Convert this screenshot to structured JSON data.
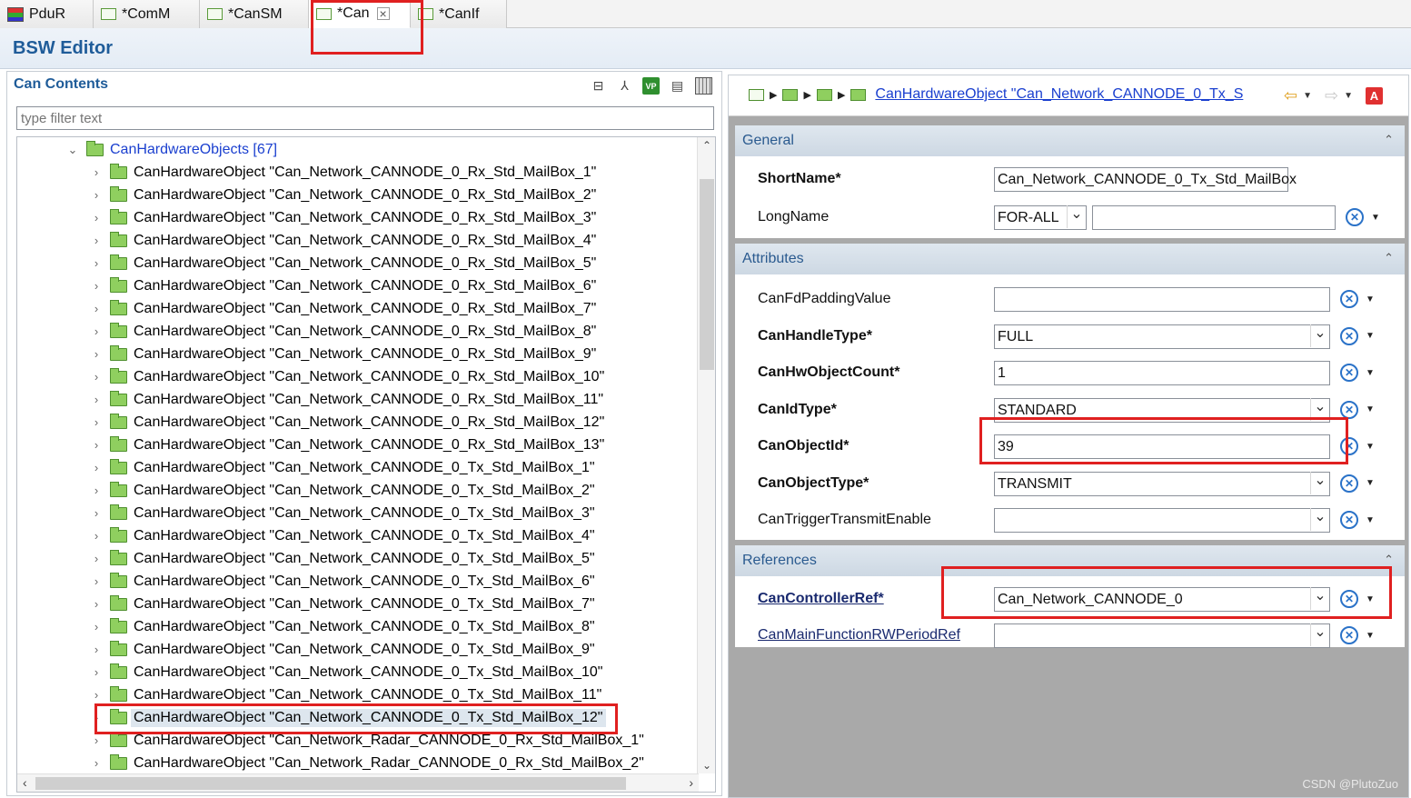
{
  "tabs": [
    {
      "label": "PduR",
      "icon": "pdur-module-icon"
    },
    {
      "label": "*ComM",
      "icon": "module-icon"
    },
    {
      "label": "*CanSM",
      "icon": "module-icon"
    },
    {
      "label": "*Can",
      "icon": "module-icon",
      "active": true
    },
    {
      "label": "*CanIf",
      "icon": "module-icon"
    }
  ],
  "editor_title": "BSW Editor",
  "left_pane": {
    "title": "Can Contents",
    "filter_placeholder": "type filter text",
    "tools": [
      "collapse-all-icon",
      "hierarchy-icon",
      "vp-res-icon",
      "document-icon",
      "grid-table-icon"
    ],
    "group_label": "CanHardwareObjects [67]",
    "items": [
      "CanHardwareObject \"Can_Network_CANNODE_0_Rx_Std_MailBox_1\"",
      "CanHardwareObject \"Can_Network_CANNODE_0_Rx_Std_MailBox_2\"",
      "CanHardwareObject \"Can_Network_CANNODE_0_Rx_Std_MailBox_3\"",
      "CanHardwareObject \"Can_Network_CANNODE_0_Rx_Std_MailBox_4\"",
      "CanHardwareObject \"Can_Network_CANNODE_0_Rx_Std_MailBox_5\"",
      "CanHardwareObject \"Can_Network_CANNODE_0_Rx_Std_MailBox_6\"",
      "CanHardwareObject \"Can_Network_CANNODE_0_Rx_Std_MailBox_7\"",
      "CanHardwareObject \"Can_Network_CANNODE_0_Rx_Std_MailBox_8\"",
      "CanHardwareObject \"Can_Network_CANNODE_0_Rx_Std_MailBox_9\"",
      "CanHardwareObject \"Can_Network_CANNODE_0_Rx_Std_MailBox_10\"",
      "CanHardwareObject \"Can_Network_CANNODE_0_Rx_Std_MailBox_11\"",
      "CanHardwareObject \"Can_Network_CANNODE_0_Rx_Std_MailBox_12\"",
      "CanHardwareObject \"Can_Network_CANNODE_0_Rx_Std_MailBox_13\"",
      "CanHardwareObject \"Can_Network_CANNODE_0_Tx_Std_MailBox_1\"",
      "CanHardwareObject \"Can_Network_CANNODE_0_Tx_Std_MailBox_2\"",
      "CanHardwareObject \"Can_Network_CANNODE_0_Tx_Std_MailBox_3\"",
      "CanHardwareObject \"Can_Network_CANNODE_0_Tx_Std_MailBox_4\"",
      "CanHardwareObject \"Can_Network_CANNODE_0_Tx_Std_MailBox_5\"",
      "CanHardwareObject \"Can_Network_CANNODE_0_Tx_Std_MailBox_6\"",
      "CanHardwareObject \"Can_Network_CANNODE_0_Tx_Std_MailBox_7\"",
      "CanHardwareObject \"Can_Network_CANNODE_0_Tx_Std_MailBox_8\"",
      "CanHardwareObject \"Can_Network_CANNODE_0_Tx_Std_MailBox_9\"",
      "CanHardwareObject \"Can_Network_CANNODE_0_Tx_Std_MailBox_10\"",
      "CanHardwareObject \"Can_Network_CANNODE_0_Tx_Std_MailBox_11\"",
      "CanHardwareObject \"Can_Network_CANNODE_0_Tx_Std_MailBox_12\"",
      "CanHardwareObject \"Can_Network_Radar_CANNODE_0_Rx_Std_MailBox_1\"",
      "CanHardwareObject \"Can_Network_Radar_CANNODE_0_Rx_Std_MailBox_2\""
    ],
    "selected_index": 24
  },
  "right_pane": {
    "breadcrumb_link": "CanHardwareObject \"Can_Network_CANNODE_0_Tx_S",
    "nav_icons": [
      "back-arrow-icon",
      "forward-arrow-icon",
      "autosar-a-icon"
    ],
    "general": {
      "title": "General",
      "shortname_label": "ShortName*",
      "shortname_value": "Can_Network_CANNODE_0_Tx_Std_MailBox",
      "longname_label": "LongName",
      "longname_lang": "FOR-ALL",
      "longname_value": ""
    },
    "attributes": {
      "title": "Attributes",
      "rows": [
        {
          "label": "CanFdPaddingValue",
          "value": "",
          "bold": false,
          "combo": false
        },
        {
          "label": "CanHandleType*",
          "value": "FULL",
          "bold": true,
          "combo": true
        },
        {
          "label": "CanHwObjectCount*",
          "value": "1",
          "bold": true,
          "combo": false
        },
        {
          "label": "CanIdType*",
          "value": "STANDARD",
          "bold": true,
          "combo": true
        },
        {
          "label": "CanObjectId*",
          "value": "39",
          "bold": true,
          "combo": false
        },
        {
          "label": "CanObjectType*",
          "value": "TRANSMIT",
          "bold": true,
          "combo": true
        },
        {
          "label": "CanTriggerTransmitEnable",
          "value": "",
          "bold": false,
          "combo": true
        }
      ]
    },
    "references": {
      "title": "References",
      "rows": [
        {
          "label": "CanControllerRef*",
          "value": "Can_Network_CANNODE_0",
          "bold": true
        },
        {
          "label": "CanMainFunctionRWPeriodRef",
          "value": "",
          "bold": false
        }
      ]
    }
  },
  "watermark": "CSDN @PlutoZuo",
  "colors": {
    "accent_title": "#1f5c99",
    "link": "#1a3fcf",
    "annotation_red": "#e02020",
    "folder_green": "#8fcf5f"
  }
}
